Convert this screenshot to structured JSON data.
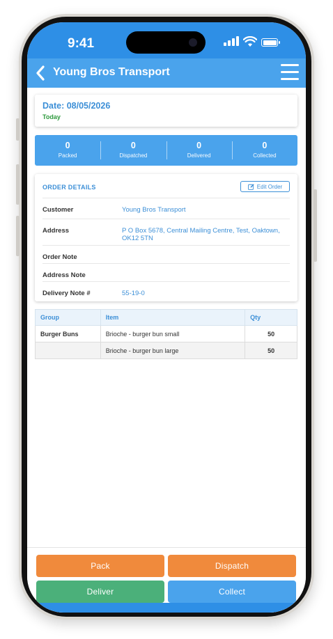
{
  "status_bar": {
    "time": "9:41"
  },
  "header": {
    "title": "Young Bros Transport"
  },
  "date_card": {
    "date_label": "Date: 08/05/2026",
    "relative": "Today"
  },
  "stats": [
    {
      "value": "0",
      "label": "Packed"
    },
    {
      "value": "0",
      "label": "Dispatched"
    },
    {
      "value": "0",
      "label": "Delivered"
    },
    {
      "value": "0",
      "label": "Collected"
    }
  ],
  "order_details": {
    "title": "ORDER DETAILS",
    "edit_label": "Edit Order",
    "rows": [
      {
        "key": "Customer",
        "value": "Young Bros Transport"
      },
      {
        "key": "Address",
        "value": "P O Box 5678, Central Mailing Centre, Test, Oaktown, OK12 5TN"
      },
      {
        "key": "Order Note",
        "value": ""
      },
      {
        "key": "Address Note",
        "value": ""
      },
      {
        "key": "Delivery Note #",
        "value": "55-19-0"
      }
    ]
  },
  "items_table": {
    "headers": [
      "Group",
      "Item",
      "Qty"
    ],
    "rows": [
      {
        "group": "Burger Buns",
        "item": "Brioche - burger bun small",
        "qty": "50"
      },
      {
        "group": "",
        "item": "Brioche - burger bun large",
        "qty": "50"
      }
    ]
  },
  "actions": {
    "pack": "Pack",
    "dispatch": "Dispatch",
    "deliver": "Deliver",
    "collect": "Collect"
  },
  "colors": {
    "primary": "#4aa3ec",
    "status_bar": "#2e8fe6",
    "accent_orange": "#f08a3c",
    "accent_green": "#4bb07a",
    "qty_red": "#c0392b",
    "today_green": "#2e9a3e"
  },
  "icons": [
    "back-chevron-icon",
    "hamburger-menu-icon",
    "edit-icon",
    "signal-icon",
    "wifi-icon",
    "battery-icon"
  ]
}
